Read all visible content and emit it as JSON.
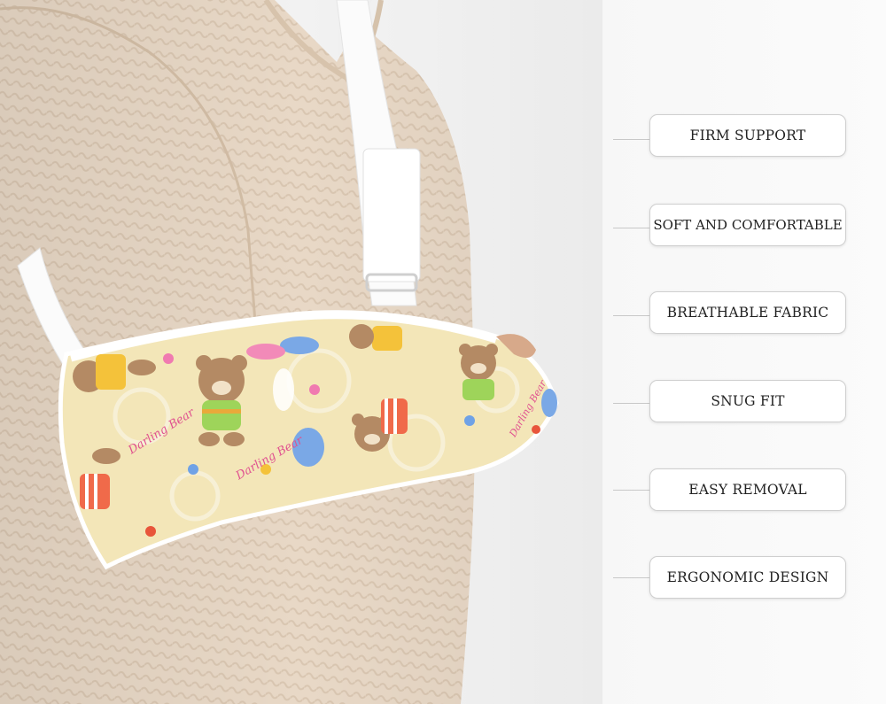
{
  "features": [
    "FIRM SUPPORT",
    "SOFT AND COMFORTABLE",
    "BREATHABLE FABRIC",
    "SNUG FIT",
    "EASY REMOVAL",
    "ERGONOMIC DESIGN"
  ],
  "colors": {
    "background": "#f4f4f4",
    "sweater": "#e9dac8",
    "sling_fabric": "#f3e6b8",
    "strap": "#ffffff",
    "label_border": "#cfcfcf",
    "label_text": "#222222"
  },
  "sling_print": {
    "text": [
      "Darling Bear",
      "Darling Bear",
      "Darling Bear"
    ]
  }
}
